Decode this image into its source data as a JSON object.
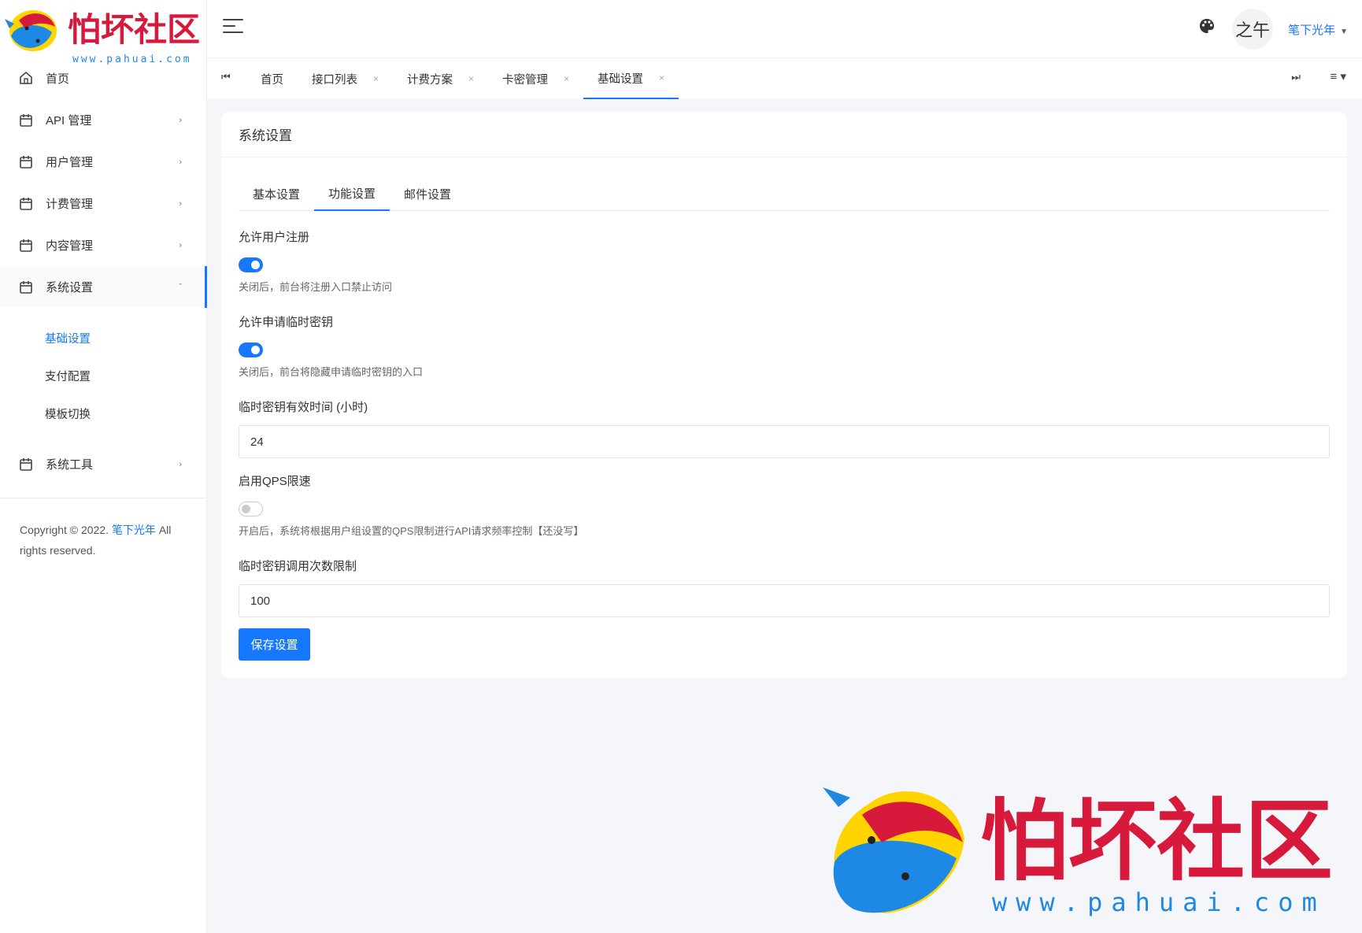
{
  "brand": {
    "logo_text": "怕坏社区",
    "logo_url_text": "www.pahuai.com"
  },
  "sidebar": {
    "items": [
      {
        "label": "首页"
      },
      {
        "label": "API 管理"
      },
      {
        "label": "用户管理"
      },
      {
        "label": "计费管理"
      },
      {
        "label": "内容管理"
      },
      {
        "label": "系统设置"
      },
      {
        "label": "系统工具"
      }
    ],
    "system_submenu": [
      {
        "label": "基础设置"
      },
      {
        "label": "支付配置"
      },
      {
        "label": "模板切换"
      }
    ],
    "copyright_prefix": "Copyright © 2022.",
    "copyright_link": "笔下光年",
    "copyright_suffix": "All rights reserved."
  },
  "header": {
    "avatar_text": "之午",
    "username": "笔下光年"
  },
  "tabs": [
    {
      "label": "首页"
    },
    {
      "label": "接口列表"
    },
    {
      "label": "计费方案"
    },
    {
      "label": "卡密管理"
    },
    {
      "label": "基础设置"
    }
  ],
  "card": {
    "title": "系统设置",
    "form_tabs": [
      {
        "label": "基本设置"
      },
      {
        "label": "功能设置"
      },
      {
        "label": "邮件设置"
      }
    ],
    "fields": {
      "allow_register": {
        "label": "允许用户注册",
        "enabled": true,
        "hint": "关闭后，前台将注册入口禁止访问"
      },
      "allow_temp_key": {
        "label": "允许申请临时密钥",
        "enabled": true,
        "hint": "关闭后，前台将隐藏申请临时密钥的入口"
      },
      "temp_key_hours": {
        "label": "临时密钥有效时间 (小时)",
        "value": "24"
      },
      "qps_limit": {
        "label": "启用QPS限速",
        "enabled": false,
        "hint": "开启后，系统将根据用户组设置的QPS限制进行API请求频率控制【还没写】"
      },
      "temp_key_calls": {
        "label": "临时密钥调用次数限制",
        "value": "100"
      }
    },
    "save_label": "保存设置"
  },
  "colors": {
    "accent": "#1677ff",
    "logo_red": "#d7193b",
    "logo_yellow": "#ffd400",
    "logo_blue": "#1e88e5"
  }
}
